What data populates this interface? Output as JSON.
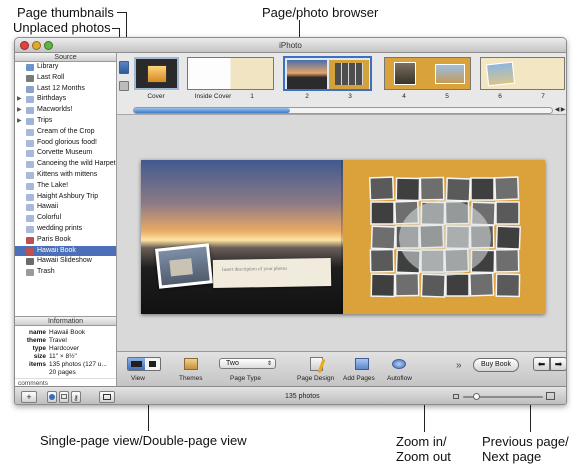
{
  "callouts": {
    "page_thumbnails": "Page thumbnails",
    "unplaced_photos": "Unplaced photos",
    "page_browser": "Page/photo browser",
    "view_toggle": "Single-page view/Double-page view",
    "zoom_in": "Zoom in/",
    "zoom_out": "Zoom out",
    "prev_page": "Previous page/",
    "next_page": "Next page"
  },
  "window": {
    "title": "iPhoto"
  },
  "source": {
    "header": "Source",
    "items": [
      {
        "label": "Library",
        "icon": "library-icon",
        "color": "#6a95c9"
      },
      {
        "label": "Last Roll",
        "icon": "film-roll-icon",
        "color": "#7a7a7a"
      },
      {
        "label": "Last 12 Months",
        "icon": "calendar-icon",
        "color": "#8aa4c8"
      },
      {
        "label": "Birthdays",
        "icon": "folder-icon",
        "color": "#9fb4d6"
      },
      {
        "label": "Macworlds!",
        "icon": "folder-icon",
        "color": "#9fb4d6"
      },
      {
        "label": "Trips",
        "icon": "folder-icon",
        "color": "#9fb4d6"
      },
      {
        "label": "Cream of the Crop",
        "icon": "album-icon",
        "color": "#a8b9da"
      },
      {
        "label": "Food glorious food!",
        "icon": "album-icon",
        "color": "#a8b9da"
      },
      {
        "label": "Corvette Museum",
        "icon": "album-icon",
        "color": "#a8b9da"
      },
      {
        "label": "Canoeing the wild Harpeth",
        "icon": "album-icon",
        "color": "#a8b9da"
      },
      {
        "label": "Kittens with mittens",
        "icon": "album-icon",
        "color": "#a8b9da"
      },
      {
        "label": "The Lake!",
        "icon": "album-icon",
        "color": "#a8b9da"
      },
      {
        "label": "Haight Ashbury Trip",
        "icon": "album-icon",
        "color": "#a8b9da"
      },
      {
        "label": "Hawaii",
        "icon": "album-icon",
        "color": "#a8b9da"
      },
      {
        "label": "Colorful",
        "icon": "album-icon",
        "color": "#a8b9da"
      },
      {
        "label": "wedding prints",
        "icon": "album-icon",
        "color": "#a8b9da"
      },
      {
        "label": "Paris Book",
        "icon": "book-icon",
        "color": "#c0504d"
      },
      {
        "label": "Hawaii Book",
        "icon": "book-icon",
        "color": "#c0504d"
      },
      {
        "label": "Hawaii Slideshow",
        "icon": "slideshow-icon",
        "color": "#6b6b6b"
      },
      {
        "label": "Trash",
        "icon": "trash-icon",
        "color": "#9a9a9a"
      }
    ]
  },
  "info": {
    "header": "Information",
    "rows": [
      {
        "key": "name",
        "value": "Hawaii Book"
      },
      {
        "key": "theme",
        "value": "Travel"
      },
      {
        "key": "type",
        "value": "Hardcover"
      },
      {
        "key": "size",
        "value": "11\" × 8½\""
      },
      {
        "key": "items",
        "value": "135 photos (127 u..."
      },
      {
        "key": "",
        "value": "20 pages"
      }
    ],
    "comments_label": "comments"
  },
  "pages": [
    {
      "label": "Cover"
    },
    {
      "label": "Inside Cover"
    },
    {
      "label": "1"
    },
    {
      "label": "2"
    },
    {
      "label": "3"
    },
    {
      "label": "4"
    },
    {
      "label": "5"
    },
    {
      "label": "6"
    },
    {
      "label": "7"
    }
  ],
  "spread": {
    "caption": "Insert description of your photos"
  },
  "toolbar": {
    "view_label": "View",
    "themes_label": "Themes",
    "page_type_value": "Two",
    "page_type_label": "Page Type",
    "page_design_label": "Page Design",
    "add_pages_label": "Add Pages",
    "autoflow_label": "Autoflow",
    "buy_book_label": "Buy Book"
  },
  "status": {
    "photo_count": "135 photos"
  }
}
